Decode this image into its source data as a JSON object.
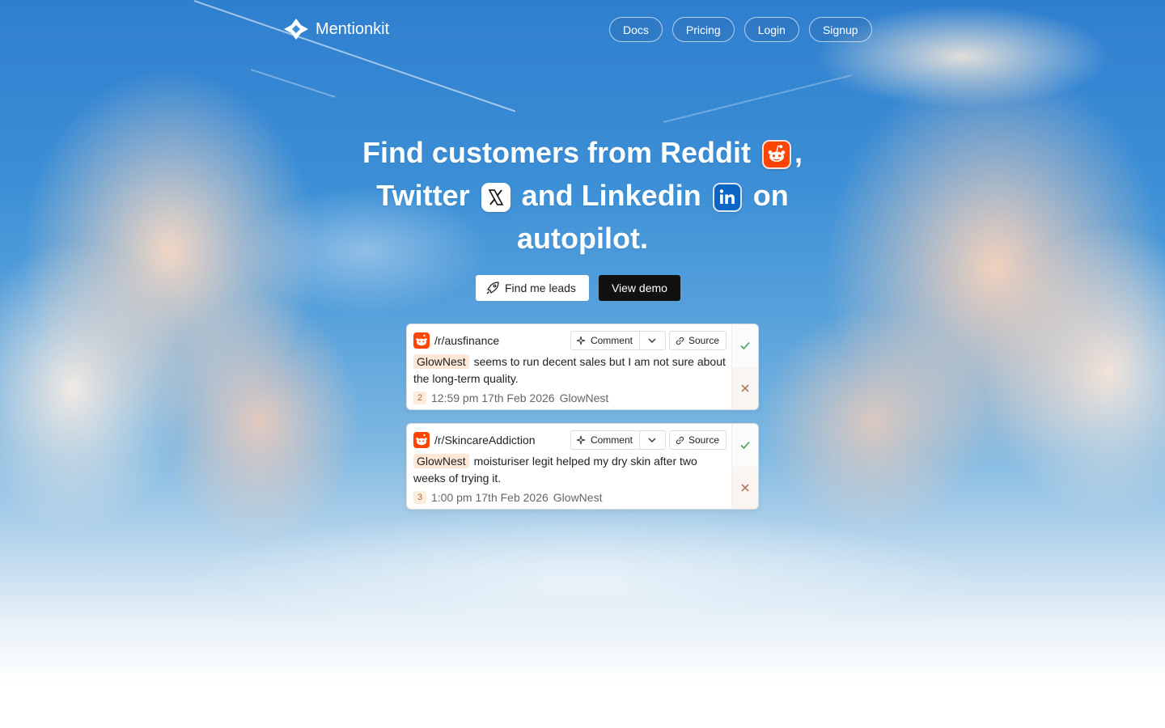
{
  "brand": {
    "name": "Mentionkit",
    "logo_icon": "mentionkit-logo-icon"
  },
  "nav": {
    "items": [
      {
        "label": "Docs"
      },
      {
        "label": "Pricing"
      },
      {
        "label": "Login"
      },
      {
        "label": "Signup"
      }
    ]
  },
  "hero": {
    "line1": "Find customers from Reddit",
    "comma": ",",
    "twitter": "Twitter",
    "and_linkedin": "and Linkedin",
    "on": "on",
    "line3": "autopilot.",
    "icons": [
      "reddit-icon",
      "x-icon",
      "linkedin-icon"
    ]
  },
  "cta": {
    "primary": "Find me leads",
    "secondary": "View demo"
  },
  "mentions": [
    {
      "subreddit": "/r/ausfinance",
      "highlight": "GlowNest",
      "text": "seems to run decent sales but I am not sure about the long-term quality.",
      "score": "2",
      "time": "12:59 pm 17th Feb 2026",
      "keyword": "GlowNest"
    },
    {
      "subreddit": "/r/SkincareAddiction",
      "highlight": "GlowNest",
      "text": "moisturiser legit helped my dry skin after two weeks of trying it.",
      "score": "3",
      "time": "1:00 pm 17th Feb 2026",
      "keyword": "GlowNest"
    }
  ],
  "card_actions": {
    "comment": "Comment",
    "source": "Source"
  },
  "colors": {
    "reddit": "#ff4500",
    "linkedin": "#0a66c2",
    "accept": "#4c9a5a",
    "reject": "#b07a5a"
  }
}
